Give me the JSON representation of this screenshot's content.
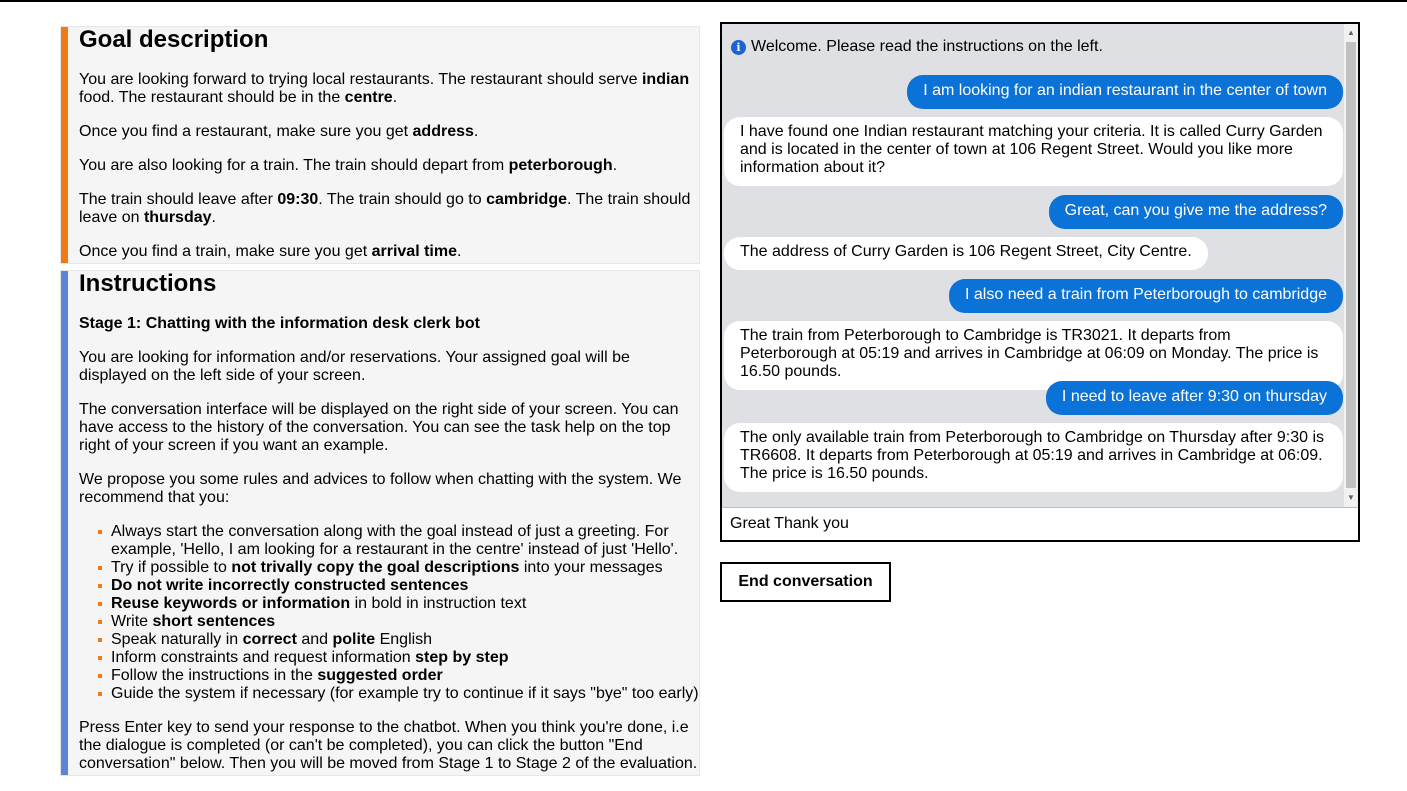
{
  "goal": {
    "title": "Goal description",
    "p1": {
      "a": "You are looking forward to trying local restaurants. The restaurant should serve ",
      "b1": "indian",
      "c": " food. The restaurant should be in the ",
      "b2": "centre",
      "d": "."
    },
    "p2": {
      "a": "Once you find a restaurant, make sure you get ",
      "b1": "address",
      "c": "."
    },
    "p3": {
      "a": "You are also looking for a train. The train should depart from ",
      "b1": "peterborough",
      "c": "."
    },
    "p4": {
      "a": "The train should leave after ",
      "b1": "09:30",
      "c": ". The train should go to ",
      "b2": "cambridge",
      "d": ". The train should leave on ",
      "b3": "thursday",
      "e": "."
    },
    "p5": {
      "a": "Once you find a train, make sure you get ",
      "b1": "arrival time",
      "c": "."
    }
  },
  "instructions": {
    "title": "Instructions",
    "stage": "Stage 1: Chatting with the information desk clerk bot",
    "p1": "You are looking for information and/or reservations. Your assigned goal will be displayed on the left side of your screen.",
    "p2": "The conversation interface will be displayed on the right side of your screen. You can have access to the history of the conversation. You can see the task help on the top right of your screen if you want an example.",
    "p3": "We propose you some rules and advices to follow when chatting with the system. We recommend that you:",
    "rules": {
      "r1": {
        "a": "Always start the conversation along with the goal instead of just a greeting. For example, 'Hello, I am looking for a restaurant in the centre' instead of just 'Hello'."
      },
      "r2": {
        "a": "Try if possible to ",
        "b": "not trivally copy the goal descriptions",
        "c": " into your messages"
      },
      "r3": {
        "b": "Do not write incorrectly constructed sentences"
      },
      "r4": {
        "b": "Reuse keywords or information",
        "c": " in bold in instruction text"
      },
      "r5": {
        "a": "Write ",
        "b": "short sentences"
      },
      "r6": {
        "a": "Speak naturally in ",
        "b": "correct",
        "c": " and ",
        "b2": "polite",
        "d": " English"
      },
      "r7": {
        "a": "Inform constraints and request information ",
        "b": "step by step"
      },
      "r8": {
        "a": "Follow the instructions in the ",
        "b": "suggested order"
      },
      "r9": {
        "a": "Guide the system if necessary (for example try to continue if it says \"bye\" too early)"
      }
    },
    "p4": "Press Enter key to send your response to the chatbot. When you think you're done, i.e the dialogue is completed (or can't be completed), you can click the button \"End conversation\" below. Then you will be moved from Stage 1 to Stage 2 of the evaluation."
  },
  "chat": {
    "welcome": "Welcome. Please read the instructions on the left.",
    "info_icon": "i",
    "messages": [
      {
        "role": "user",
        "text": "I am looking for an indian restaurant in the center of town"
      },
      {
        "role": "bot",
        "text": "I have found one Indian restaurant matching your criteria. It is called Curry Garden and is located in the center of town at 106 Regent Street. Would you like more information about it?"
      },
      {
        "role": "user",
        "text": "Great, can you give me the address?"
      },
      {
        "role": "bot",
        "text": "The address of Curry Garden is 106 Regent Street, City Centre."
      },
      {
        "role": "user",
        "text": "I also need a train from Peterborough to cambridge"
      },
      {
        "role": "bot",
        "text": "The train from Peterborough to Cambridge is TR3021. It departs from Peterborough at 05:19 and arrives in Cambridge at 06:09 on Monday. The price is 16.50 pounds."
      },
      {
        "role": "user",
        "text": "I need to leave after 9:30 on thursday"
      },
      {
        "role": "bot",
        "text": "The only available train from Peterborough to Cambridge on Thursday after 9:30 is TR6608. It departs from Peterborough at 05:19 and arrives in Cambridge at 06:09. The price is 16.50 pounds."
      }
    ],
    "input_value": "Great Thank you"
  },
  "end_button": "End conversation",
  "colors": {
    "goal_accent": "#f07b14",
    "instructions_accent": "#5b86d8",
    "user_bubble": "#0b72d8",
    "chat_bg": "#dfe0e3"
  }
}
